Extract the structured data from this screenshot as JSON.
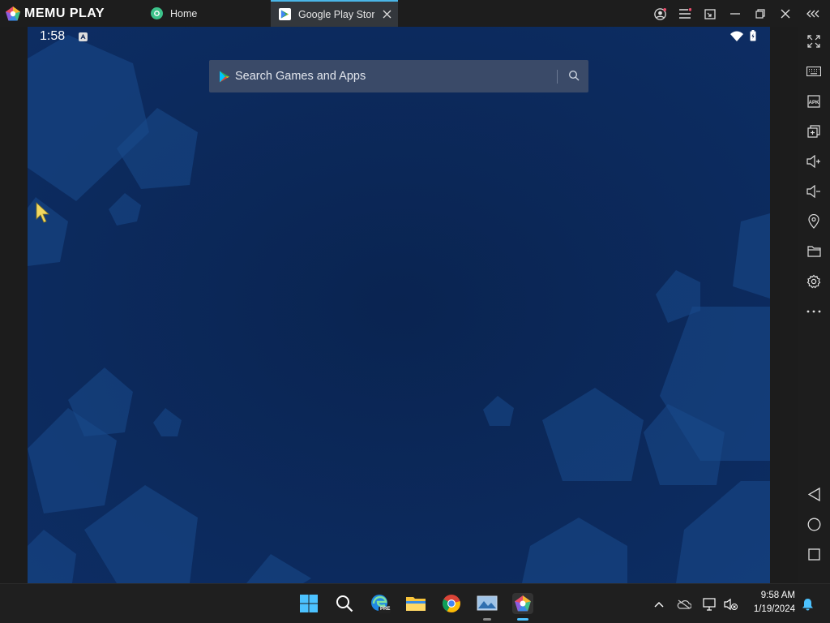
{
  "app": {
    "name": "MEMU PLAY",
    "accent": "#4ab6e8"
  },
  "tabs": [
    {
      "label": "Home",
      "icon": "memu-home-icon"
    },
    {
      "label": "Google Play Store",
      "icon": "play-store-icon",
      "active": true
    }
  ],
  "android": {
    "clock": "1:58",
    "search": {
      "placeholder": "Search Games and Apps"
    }
  },
  "sidebar": {
    "items": [
      "fullscreen",
      "keyboard",
      "apk",
      "multi-instance",
      "volume-up",
      "volume-down",
      "location",
      "folder",
      "settings",
      "more",
      "back",
      "home",
      "recents"
    ]
  },
  "taskbar": {
    "time": "9:58 AM",
    "date": "1/19/2024",
    "edge_badge": "PRE"
  },
  "colors": {
    "android_bg": "#0b2453",
    "search_bg": "#3a4a68"
  }
}
